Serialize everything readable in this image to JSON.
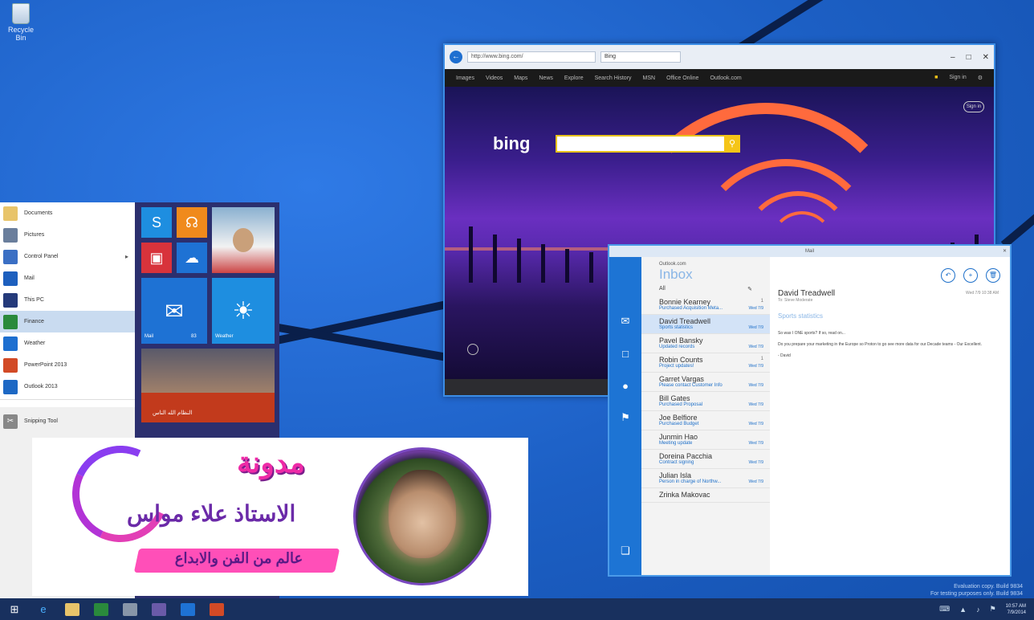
{
  "desktop": {
    "recycle_label": "Recycle Bin"
  },
  "browser": {
    "address": "http://www.bing.com/",
    "tab_label": "Bing",
    "nav": [
      "Images",
      "Videos",
      "Maps",
      "News",
      "Explore",
      "Search History",
      "MSN",
      "Office Online",
      "Outlook.com"
    ],
    "signin": "Sign in",
    "bing_logo": "bing"
  },
  "mail": {
    "title": "Mail",
    "account": "Outlook.com",
    "folder": "Inbox",
    "filter": "All",
    "messages": [
      {
        "from": "Bonnie Kearney",
        "subject": "Purchased Acquisition Meta...",
        "meta": "1",
        "date": "Wed 7/9"
      },
      {
        "from": "David Treadwell",
        "subject": "Sports statistics",
        "meta": "",
        "date": "Wed 7/9"
      },
      {
        "from": "Pavel Bansky",
        "subject": "Updated records",
        "meta": "",
        "date": "Wed 7/9"
      },
      {
        "from": "Robin Counts",
        "subject": "Project updates!",
        "meta": "1",
        "date": "Wed 7/9"
      },
      {
        "from": "Garret Vargas",
        "subject": "Please contact Customer Info",
        "meta": "",
        "date": "Wed 7/9"
      },
      {
        "from": "Bill Gates",
        "subject": "Purchased Proposal",
        "meta": "",
        "date": "Wed 7/9"
      },
      {
        "from": "Joe Belfiore",
        "subject": "Purchased Budget",
        "meta": "",
        "date": "Wed 7/9"
      },
      {
        "from": "Junmin Hao",
        "subject": "Meeting update",
        "meta": "",
        "date": "Wed 7/9"
      },
      {
        "from": "Doreina Pacchia",
        "subject": "Contract signing",
        "meta": "",
        "date": "Wed 7/9"
      },
      {
        "from": "Julian Isla",
        "subject": "Person in charge of Northw...",
        "meta": "",
        "date": "Wed 7/9"
      },
      {
        "from": "Zrinka Makovac",
        "subject": "",
        "meta": "",
        "date": ""
      }
    ],
    "reader": {
      "from": "David Treadwell",
      "to": "To: Steve Moderate",
      "date": "Wed 7/9 10:38 AM",
      "subject": "Sports statistics",
      "body1": "So was I ONE sports? If so, read on...",
      "body2": "Do you prepare your marketing in the Europe so Proton to go see more data for our Decade teams - Our Excellent.",
      "body3": "- David"
    }
  },
  "start_menu": {
    "items": [
      {
        "label": "Documents",
        "color": "#e8c46a"
      },
      {
        "label": "Pictures",
        "color": "#6a7e9c"
      },
      {
        "label": "Control Panel",
        "color": "#3a6fc4"
      },
      {
        "label": "Mail",
        "color": "#1d5fbe"
      },
      {
        "label": "This PC",
        "color": "#253a7a"
      },
      {
        "label": "Finance",
        "color": "#2a8a3c"
      },
      {
        "label": "Weather",
        "color": "#1d6fd0"
      },
      {
        "label": "PowerPoint 2013",
        "color": "#d24a26"
      },
      {
        "label": "Outlook 2013",
        "color": "#1d68c4"
      }
    ],
    "snipping": "Snipping Tool",
    "tiles": {
      "mail": "Mail",
      "mail_count": "83",
      "weather": "Weather",
      "news": "النظام الله الناس"
    }
  },
  "taskbar": {
    "clock_time": "10:57 AM",
    "clock_date": "7/9/2014",
    "watermark1": "Evaluation copy. Build 9834",
    "watermark2": "For testing purposes only. Build 9834"
  },
  "banner": {
    "title": "مدونة",
    "name": "الاستاذ علاء مواس",
    "tagline": "عالم من الفن والابداع",
    "accent": "#ee2aa6",
    "accent2": "#6b2aa8"
  }
}
